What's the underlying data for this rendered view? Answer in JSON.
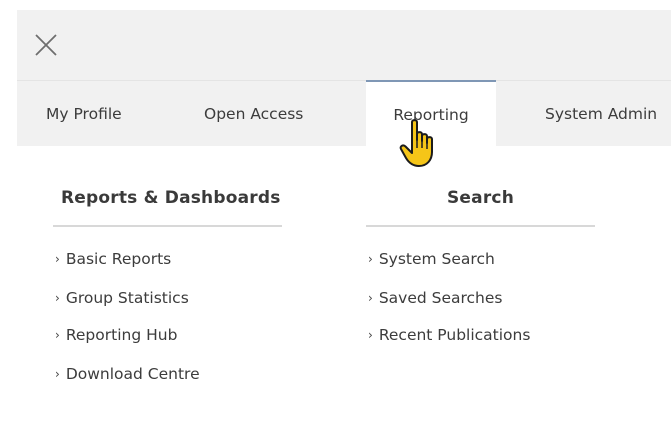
{
  "tabs": [
    {
      "label": "My Profile"
    },
    {
      "label": "Open Access"
    },
    {
      "label": "Reporting"
    },
    {
      "label": "System Admin"
    }
  ],
  "columns": [
    {
      "heading": "Reports & Dashboards",
      "links": [
        "Basic Reports",
        "Group Statistics",
        "Reporting Hub",
        "Download Centre"
      ]
    },
    {
      "heading": "Search",
      "links": [
        "System Search",
        "Saved Searches",
        "Recent Publications"
      ]
    }
  ],
  "icons": {
    "close": "close-icon",
    "chevron": "›",
    "cursor": "hand-pointer-icon"
  },
  "colors": {
    "active_tab_accent": "#7f97b5",
    "bar_background": "#f1f1f1",
    "cursor_fill": "#f5c518"
  }
}
